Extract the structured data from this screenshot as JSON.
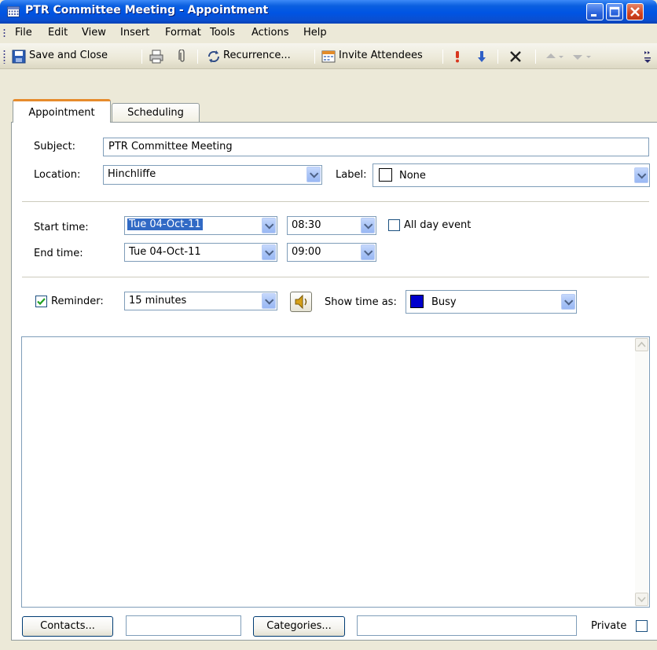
{
  "window": {
    "title": "PTR Committee Meeting - Appointment"
  },
  "menu": [
    "File",
    "Edit",
    "View",
    "Insert",
    "Format",
    "Tools",
    "Actions",
    "Help"
  ],
  "toolbar": {
    "save_close": "Save and Close",
    "recurrence": "Recurrence...",
    "invite": "Invite Attendees"
  },
  "tabs": {
    "appointment": "Appointment",
    "scheduling": "Scheduling"
  },
  "form": {
    "subject_label": "Subject:",
    "subject_value": "PTR Committee Meeting",
    "location_label": "Location:",
    "location_value": "Hinchliffe",
    "label_label": "Label:",
    "label_value": "None",
    "start_label": "Start time:",
    "start_date": "Tue 04-Oct-11",
    "start_time": "08:30",
    "end_label": "End time:",
    "end_date": "Tue 04-Oct-11",
    "end_time": "09:00",
    "all_day_label": "All day event",
    "all_day_checked": false,
    "reminder_label": "Reminder:",
    "reminder_checked": true,
    "reminder_value": "15 minutes",
    "show_time_label": "Show time as:",
    "show_time_value": "Busy",
    "busy_color": "#0000cc"
  },
  "footer": {
    "contacts": "Contacts...",
    "categories": "Categories...",
    "private_label": "Private",
    "private_checked": false
  },
  "colors": {
    "title_bar": "#0054e3",
    "tab_accent": "#e68b2c",
    "selection": "#316ac5"
  }
}
